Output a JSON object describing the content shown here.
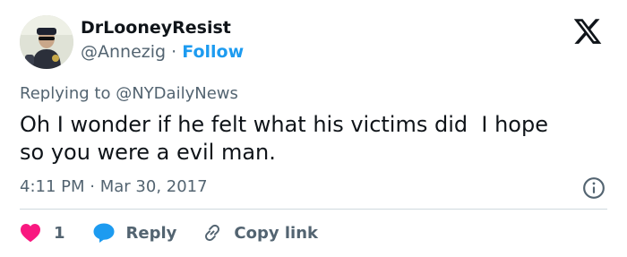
{
  "author": {
    "display_name": "DrLooneyResist",
    "handle": "@Annezig",
    "separator": "·",
    "follow_label": "Follow"
  },
  "tweet": {
    "reply_prefix": "Replying to",
    "reply_to": "@NYDailyNews",
    "text": "Oh I wonder if he felt what his victims did  I hope\nso you were a evil man.",
    "time": "4:11 PM",
    "date_separator": "·",
    "date": "Mar 30, 2017"
  },
  "actions": {
    "like_count": "1",
    "reply_label": "Reply",
    "copy_link_label": "Copy link"
  },
  "icons": {
    "brand": "x-logo-icon",
    "info": "info-icon",
    "like": "heart-icon",
    "reply": "speech-bubble-icon",
    "copy": "link-icon"
  },
  "colors": {
    "accent": "#1d9bf0",
    "like": "#f91880",
    "secondary_text": "#536471",
    "primary_text": "#0f1419",
    "divider": "#cfd9de"
  }
}
